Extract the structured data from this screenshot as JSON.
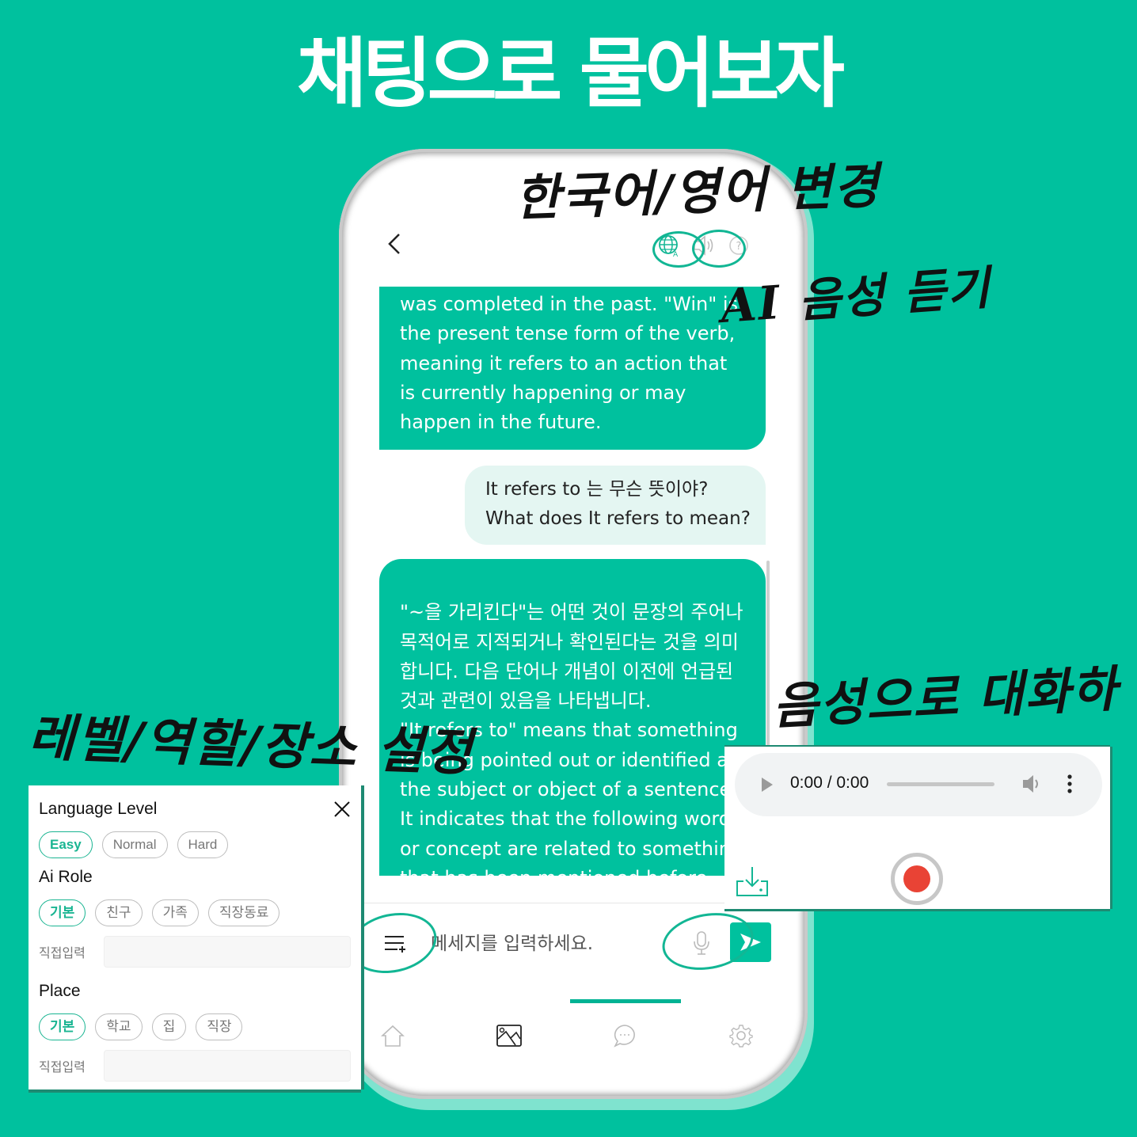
{
  "headline": "채팅으로 물어보자",
  "annotations": {
    "language_toggle": "한국어/영어 변경",
    "ai_voice": "AI 음성 듣기",
    "voice_chat": "음성으로 대화하기",
    "settings": "레벨/역할/장소 설정"
  },
  "colors": {
    "brand": "#00c19e",
    "user_bubble": "#e4f6f2",
    "record": "#e94335"
  },
  "chat": {
    "top_icons": [
      "globe-translate-icon",
      "speaker-icon",
      "help-icon"
    ],
    "messages": [
      {
        "role": "ai",
        "text": "was completed in the past. \"Win\" is the present tense form of the verb, meaning it refers to an action that is currently happening or may happen in the future."
      },
      {
        "role": "user",
        "line1": "It refers to 는 무슨 뜻이야?",
        "line2": "What does It refers to mean?"
      },
      {
        "role": "ai",
        "text": "\"~을 가리킨다\"는 어떤 것이 문장의 주어나 목적어로 지적되거나 확인된다는 것을 의미합니다. 다음 단어나 개념이 이전에 언급된 것과 관련이 있음을 나타냅니다.\n\"It refers to\" means that something is being pointed out or identified as the subject or object of a sentence. It indicates that the following words or concept are related to something that has been mentioned before."
      }
    ],
    "input_placeholder": "메세지를 입력하세요."
  },
  "nav": {
    "items": [
      "home",
      "image",
      "chat",
      "settings"
    ],
    "active": "image"
  },
  "settings_panel": {
    "language_level": {
      "title": "Language Level",
      "options": [
        "Easy",
        "Normal",
        "Hard"
      ],
      "selected": "Easy"
    },
    "ai_role": {
      "title": "Ai Role",
      "options": [
        "기본",
        "친구",
        "가족",
        "직장동료"
      ],
      "selected": "기본",
      "direct_input_label": "직접입력",
      "direct_input_value": ""
    },
    "place": {
      "title": "Place",
      "options": [
        "기본",
        "학교",
        "집",
        "직장"
      ],
      "selected": "기본",
      "direct_input_label": "직접입력",
      "direct_input_value": ""
    }
  },
  "audio_panel": {
    "time_display": "0:00 / 0:00",
    "progress": 0
  }
}
